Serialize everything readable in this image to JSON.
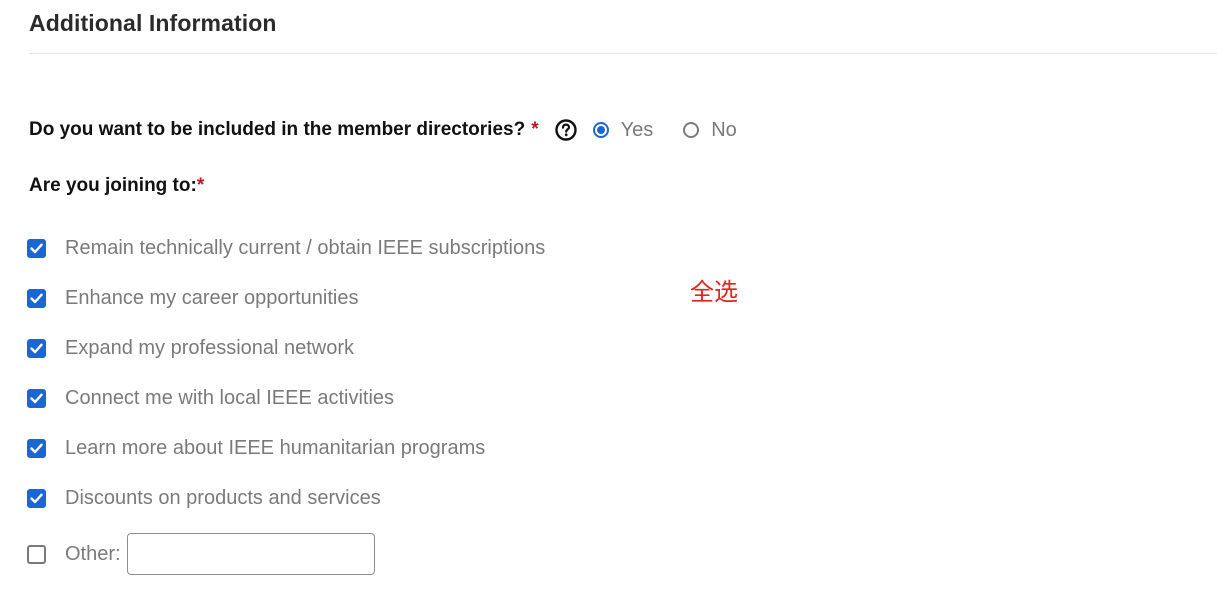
{
  "section": {
    "title": "Additional Information"
  },
  "directory_question": {
    "label": "Do you want to be included in the member directories?",
    "required_mark": "*",
    "help_icon": "question-circle-icon",
    "options": [
      {
        "label": "Yes",
        "selected": true
      },
      {
        "label": "No",
        "selected": false
      }
    ]
  },
  "joining_question": {
    "label": "Are you joining to:",
    "required_mark": "*",
    "options": [
      {
        "label": "Remain technically current / obtain IEEE subscriptions",
        "checked": true
      },
      {
        "label": "Enhance my career opportunities",
        "checked": true
      },
      {
        "label": "Expand my professional network",
        "checked": true
      },
      {
        "label": "Connect me with local IEEE activities",
        "checked": true
      },
      {
        "label": "Learn more about IEEE humanitarian programs",
        "checked": true
      },
      {
        "label": "Discounts on products and services",
        "checked": true
      },
      {
        "label": "Other:",
        "checked": false
      }
    ],
    "other_value": ""
  },
  "annotation": {
    "text": "全选",
    "color": "#e8211b"
  },
  "colors": {
    "accent": "#1a67d2",
    "required": "#c2141b",
    "muted_text": "#7a7a7a"
  }
}
